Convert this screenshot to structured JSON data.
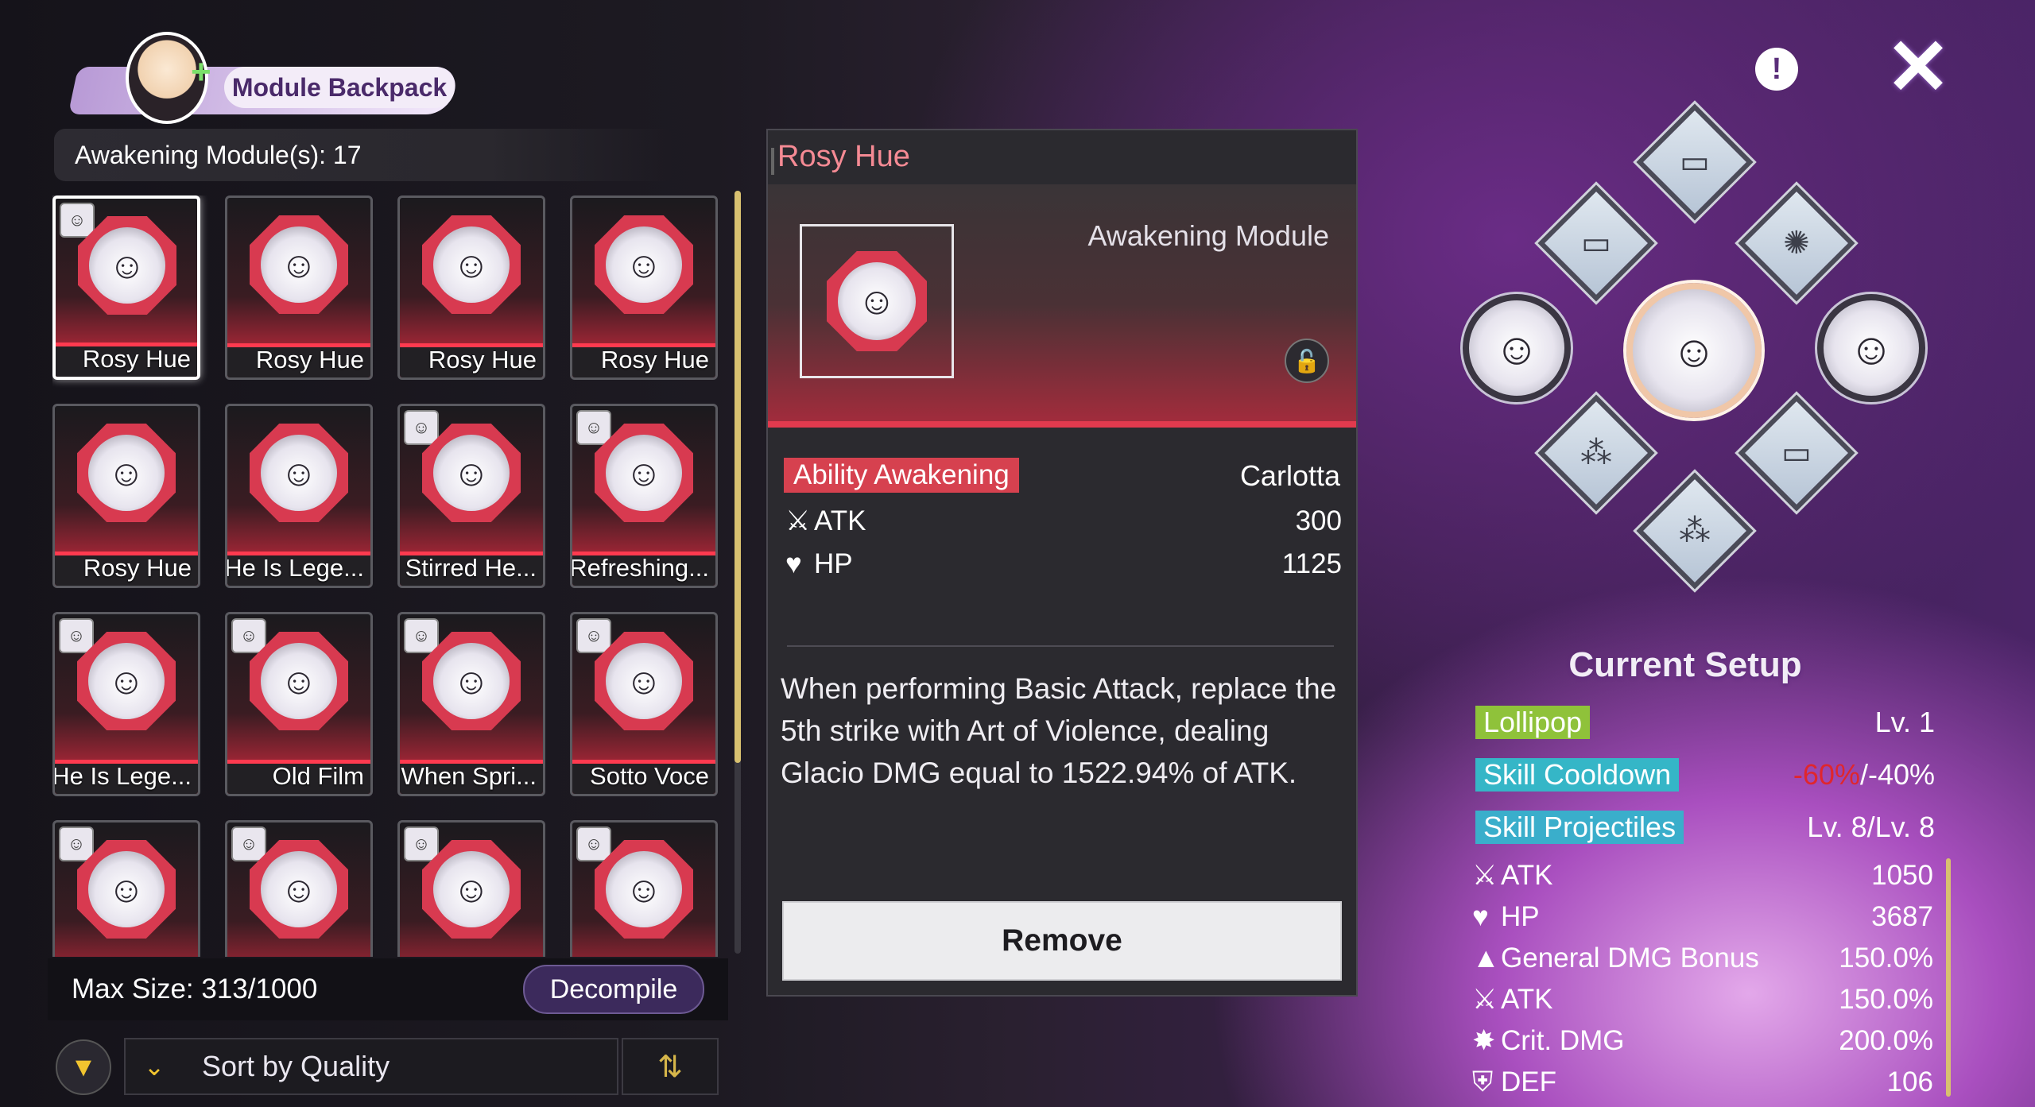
{
  "header": {
    "title": "Module Backpack"
  },
  "backpack": {
    "count_label": "Awakening Module(s): 17",
    "max_size": "Max Size: 313/1000",
    "decompile": "Decompile",
    "sort_label": "Sort by Quality"
  },
  "modules": [
    {
      "label": "Rosy Hue",
      "selected": true,
      "chip": "☺"
    },
    {
      "label": "Rosy Hue",
      "selected": false,
      "chip": ""
    },
    {
      "label": "Rosy Hue",
      "selected": false,
      "chip": ""
    },
    {
      "label": "Rosy Hue",
      "selected": false,
      "chip": ""
    },
    {
      "label": "Rosy Hue",
      "selected": false,
      "chip": ""
    },
    {
      "label": "He Is Lege...",
      "selected": false,
      "chip": ""
    },
    {
      "label": "Stirred He...",
      "selected": false,
      "chip": "☺"
    },
    {
      "label": "Refreshing...",
      "selected": false,
      "chip": "☺"
    },
    {
      "label": "He Is Lege...",
      "selected": false,
      "chip": "☺"
    },
    {
      "label": "Old Film",
      "selected": false,
      "chip": "☺"
    },
    {
      "label": "When Spri...",
      "selected": false,
      "chip": "☺"
    },
    {
      "label": "Sotto Voce",
      "selected": false,
      "chip": "☺"
    },
    {
      "label": "",
      "selected": false,
      "chip": "☺"
    },
    {
      "label": "",
      "selected": false,
      "chip": "☺"
    },
    {
      "label": "",
      "selected": false,
      "chip": "☺"
    },
    {
      "label": "",
      "selected": false,
      "chip": "☺"
    }
  ],
  "detail": {
    "title": "Rosy Hue",
    "type": "Awakening Module",
    "tag": "Ability Awakening",
    "character": "Carlotta",
    "stats": [
      {
        "icon": "atk-icon",
        "symbol": "⚔",
        "name": "ATK",
        "value": "300"
      },
      {
        "icon": "hp-icon",
        "symbol": "♥",
        "name": "HP",
        "value": "1125"
      }
    ],
    "description": "When performing Basic Attack, replace the 5th strike with Art of Violence, dealing Glacio DMG equal to 1522.94% of ATK.",
    "remove": "Remove"
  },
  "setup": {
    "title": "Current Setup",
    "lollipop": {
      "label": "Lollipop",
      "value": "Lv. 1"
    },
    "cooldown": {
      "label": "Skill Cooldown",
      "value_red": "-60%",
      "value_rest": "/-40%"
    },
    "projectiles": {
      "label": "Skill Projectiles",
      "value": "Lv. 8/Lv. 8"
    },
    "stats": [
      {
        "icon": "atk-icon",
        "symbol": "⚔",
        "name": "ATK",
        "value": "1050"
      },
      {
        "icon": "hp-icon",
        "symbol": "♥",
        "name": "HP",
        "value": "3687"
      },
      {
        "icon": "dmg-bonus-icon",
        "symbol": "▲",
        "name": "General DMG Bonus",
        "value": "150.0%"
      },
      {
        "icon": "atk-icon",
        "symbol": "⚔",
        "name": "ATK",
        "value": "150.0%"
      },
      {
        "icon": "crit-dmg-icon",
        "symbol": "✸",
        "name": "Crit. DMG",
        "value": "200.0%"
      },
      {
        "icon": "def-icon",
        "symbol": "⛨",
        "name": "DEF",
        "value": "106"
      }
    ]
  },
  "icons": {
    "info": "!",
    "close": "✕",
    "filter": "▼",
    "chevron": "⌄",
    "sort_order": "⇅",
    "lock": "🔓"
  }
}
